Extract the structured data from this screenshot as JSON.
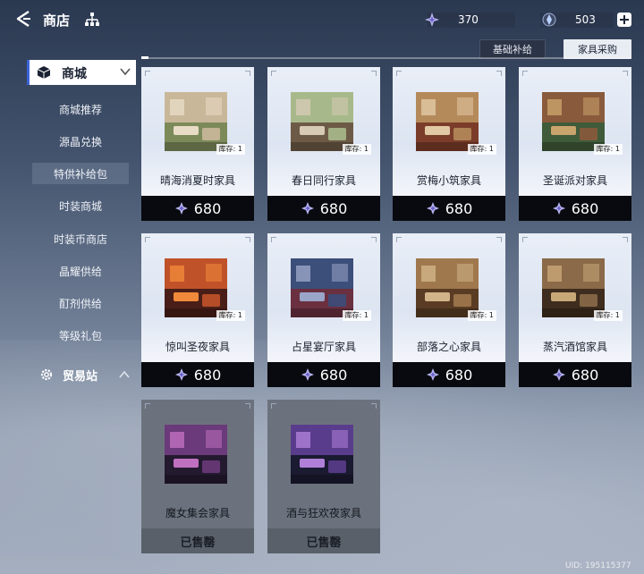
{
  "header": {
    "title": "商店"
  },
  "currencies": [
    {
      "icon": "star-crystal-icon",
      "value": "370"
    },
    {
      "icon": "crystal-gem-icon",
      "value": "503"
    }
  ],
  "tabs": [
    {
      "label": "基础补给",
      "active": false
    },
    {
      "label": "家具采购",
      "active": true
    }
  ],
  "sidebar": {
    "section": "商城",
    "items": [
      {
        "label": "商城推荐",
        "active": false
      },
      {
        "label": "源晶兑换",
        "active": false
      },
      {
        "label": "特供补给包",
        "active": true
      },
      {
        "label": "时装商城",
        "active": false
      },
      {
        "label": "时装币商店",
        "active": false
      },
      {
        "label": "晶耀供给",
        "active": false
      },
      {
        "label": "酊剂供给",
        "active": false
      },
      {
        "label": "等级礼包",
        "active": false
      }
    ],
    "trade": "贸易站"
  },
  "products": [
    {
      "name": "晴海消夏时家具",
      "stock": "库存: 1",
      "price": "680",
      "sold": false,
      "palette": [
        "#c9b79a",
        "#7c8a5a",
        "#e9dcc6"
      ]
    },
    {
      "name": "春日同行家具",
      "stock": "库存: 1",
      "price": "680",
      "sold": false,
      "palette": [
        "#a7b98b",
        "#6d5a46",
        "#d7cbb5"
      ]
    },
    {
      "name": "赏梅小筑家具",
      "stock": "库存: 1",
      "price": "680",
      "sold": false,
      "palette": [
        "#b58a5b",
        "#7b3d2a",
        "#e1c9a6"
      ]
    },
    {
      "name": "圣诞派对家具",
      "stock": "库存: 1",
      "price": "680",
      "sold": false,
      "palette": [
        "#8a5a3c",
        "#3f5b3a",
        "#c9a46c"
      ]
    },
    {
      "name": "惊叫圣夜家具",
      "stock": "库存: 1",
      "price": "680",
      "sold": false,
      "palette": [
        "#c0522a",
        "#4a1e18",
        "#f08a3a"
      ]
    },
    {
      "name": "占星宴厅家具",
      "stock": "库存: 1",
      "price": "680",
      "sold": false,
      "palette": [
        "#3c4e7a",
        "#6a3040",
        "#9aa6c8"
      ]
    },
    {
      "name": "部落之心家具",
      "stock": "库存: 1",
      "price": "680",
      "sold": false,
      "palette": [
        "#a0784e",
        "#5a3c24",
        "#d2b48a"
      ]
    },
    {
      "name": "蒸汽酒馆家具",
      "stock": "库存: 1",
      "price": "680",
      "sold": false,
      "palette": [
        "#8a6a48",
        "#3e2c1e",
        "#c9a878"
      ]
    },
    {
      "name": "魔女集会家具",
      "sold_label": "已售罄",
      "sold": true,
      "palette": [
        "#6a3a7a",
        "#241a30",
        "#c070c0"
      ]
    },
    {
      "name": "酒与狂欢夜家具",
      "sold_label": "已售罄",
      "sold": true,
      "palette": [
        "#5a3c8c",
        "#1a1a30",
        "#b080d8"
      ]
    }
  ],
  "footer": {
    "uid": "UID: 195115377"
  }
}
